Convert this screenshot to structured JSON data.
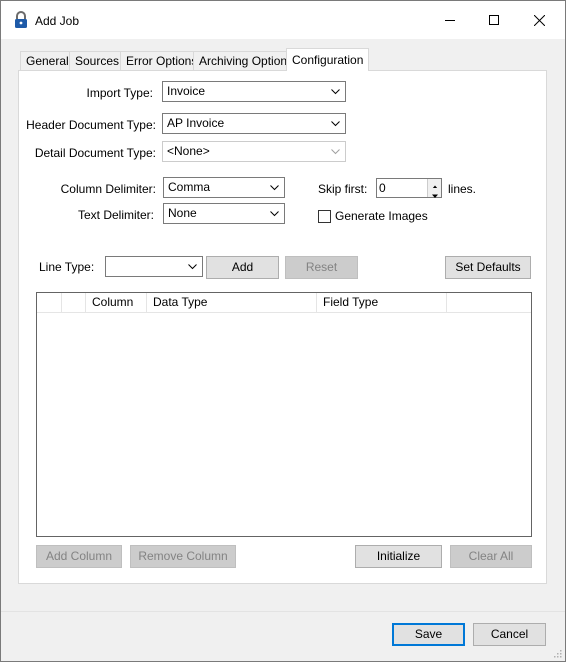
{
  "window": {
    "title": "Add Job"
  },
  "tabs": [
    {
      "label": "General",
      "active": false
    },
    {
      "label": "Sources",
      "active": false
    },
    {
      "label": "Error Options",
      "active": false
    },
    {
      "label": "Archiving Options",
      "active": false
    },
    {
      "label": "Configuration",
      "active": true
    }
  ],
  "form": {
    "import_type": {
      "label": "Import Type:",
      "value": "Invoice"
    },
    "header_doc_type": {
      "label": "Header Document Type:",
      "value": "AP Invoice"
    },
    "detail_doc_type": {
      "label": "Detail Document Type:",
      "value": "<None>"
    },
    "column_delimiter": {
      "label": "Column Delimiter:",
      "value": "Comma"
    },
    "text_delimiter": {
      "label": "Text Delimiter:",
      "value": "None"
    },
    "skip_first": {
      "label": "Skip first:",
      "value": "0",
      "suffix": "lines."
    },
    "generate_images": {
      "label": "Generate Images",
      "checked": false
    },
    "line_type": {
      "label": "Line Type:",
      "value": ""
    }
  },
  "buttons": {
    "add": "Add",
    "reset": "Reset",
    "set_defaults": "Set Defaults",
    "add_column": "Add Column",
    "remove_column": "Remove Column",
    "initialize": "Initialize",
    "clear_all": "Clear All",
    "save": "Save",
    "cancel": "Cancel"
  },
  "grid": {
    "columns": [
      "",
      "",
      "Column",
      "Data Type",
      "Field Type",
      ""
    ],
    "rows": []
  },
  "colors": {
    "accent": "#0078d7",
    "lock_icon": "#1e5aa8"
  }
}
